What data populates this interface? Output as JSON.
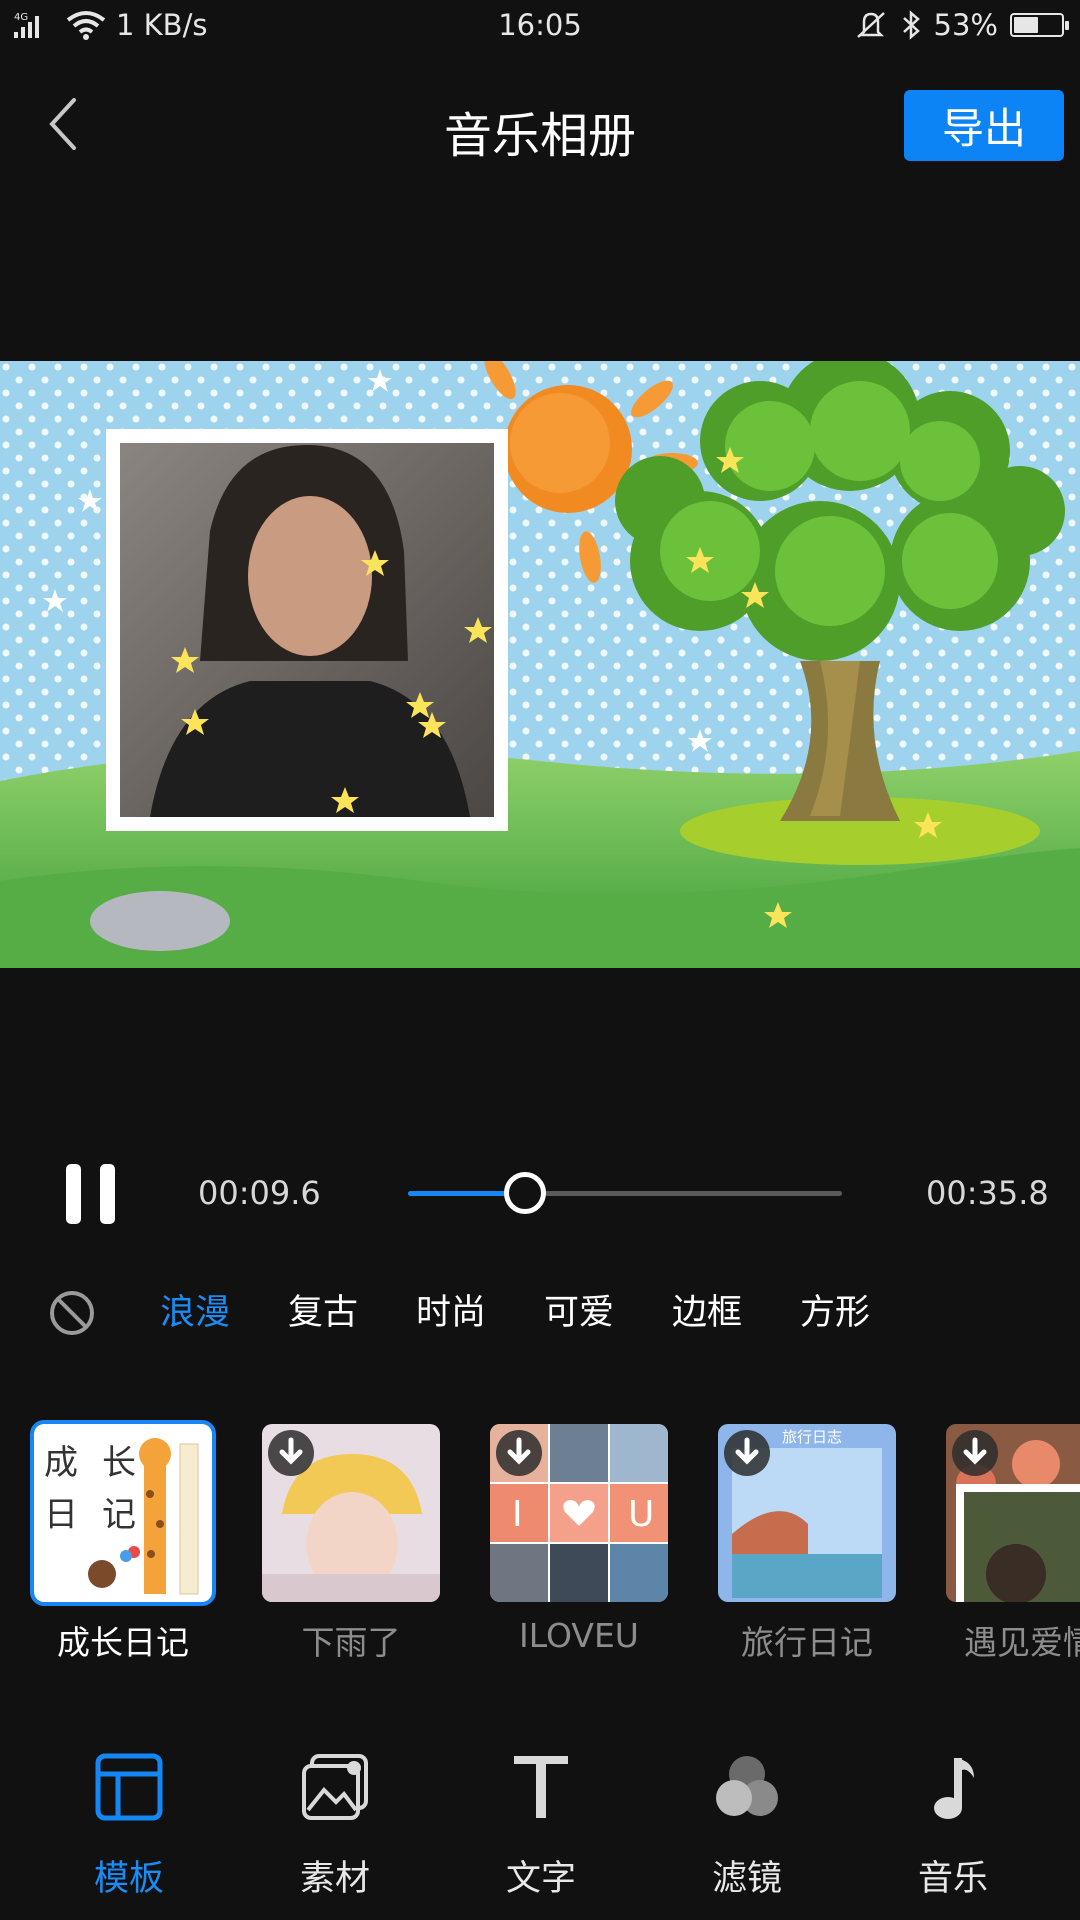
{
  "status": {
    "signal": "4G",
    "network_speed": "1 KB/s",
    "time": "16:05",
    "battery": "53%",
    "battery_level": 0.53
  },
  "header": {
    "title": "音乐相册",
    "export_label": "导出"
  },
  "player": {
    "current_time": "00:09.6",
    "total_time": "00:35.8",
    "progress": 0.27
  },
  "categories": [
    {
      "label": "浪漫",
      "active": true
    },
    {
      "label": "复古",
      "active": false
    },
    {
      "label": "时尚",
      "active": false
    },
    {
      "label": "可爱",
      "active": false
    },
    {
      "label": "边框",
      "active": false
    },
    {
      "label": "方形",
      "active": false
    }
  ],
  "templates": [
    {
      "name": "成长日记",
      "selected": true,
      "thumb_text": [
        "成",
        "长",
        "日",
        "记"
      ]
    },
    {
      "name": "下雨了",
      "selected": false
    },
    {
      "name": "ILOVEU",
      "selected": false,
      "thumb_text": [
        "I",
        "U"
      ]
    },
    {
      "name": "旅行日记",
      "selected": false,
      "thumb_text": "旅行日志"
    },
    {
      "name": "遇见爱情",
      "selected": false
    }
  ],
  "bottom_nav": [
    {
      "label": "模板",
      "icon": "template-icon",
      "active": true
    },
    {
      "label": "素材",
      "icon": "media-icon",
      "active": false
    },
    {
      "label": "文字",
      "icon": "text-icon",
      "active": false
    },
    {
      "label": "滤镜",
      "icon": "filter-icon",
      "active": false
    },
    {
      "label": "音乐",
      "icon": "music-icon",
      "active": false
    }
  ],
  "colors": {
    "accent": "#1487f5",
    "background": "#111112",
    "inactive_text": "#8d8d8d"
  }
}
